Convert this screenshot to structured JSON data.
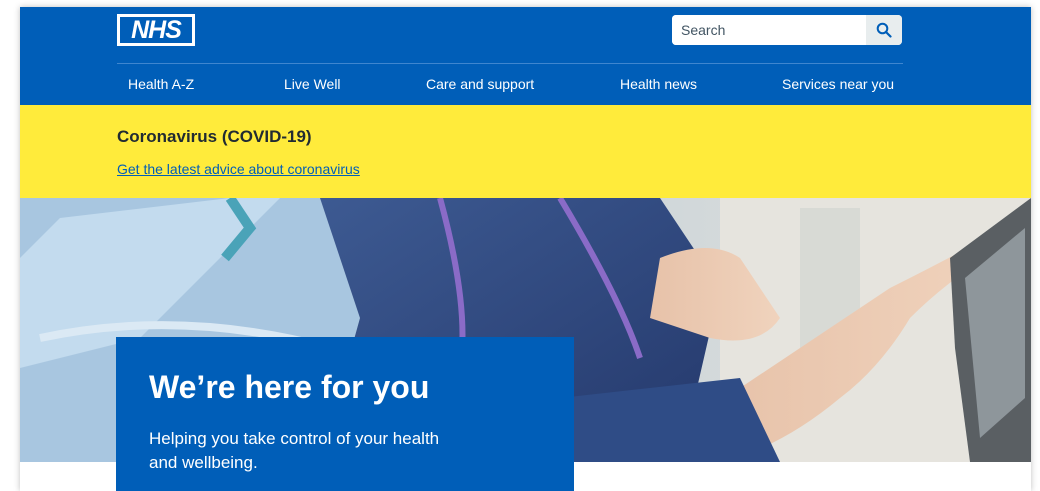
{
  "header": {
    "logo_text": "NHS",
    "search": {
      "placeholder": "Search",
      "button_icon": "search-icon"
    },
    "nav": [
      "Health A-Z",
      "Live Well",
      "Care and support",
      "Health news",
      "Services near you"
    ]
  },
  "alert": {
    "title": "Coronavirus (COVID-19)",
    "link": "Get the latest advice about coronavirus"
  },
  "hero": {
    "title": "We’re here for you",
    "subtitle": "Helping you take control of your health and wellbeing."
  },
  "colors": {
    "nhs_blue": "#005eb8",
    "alert_yellow": "#ffeb3b",
    "text_dark": "#212b32"
  }
}
